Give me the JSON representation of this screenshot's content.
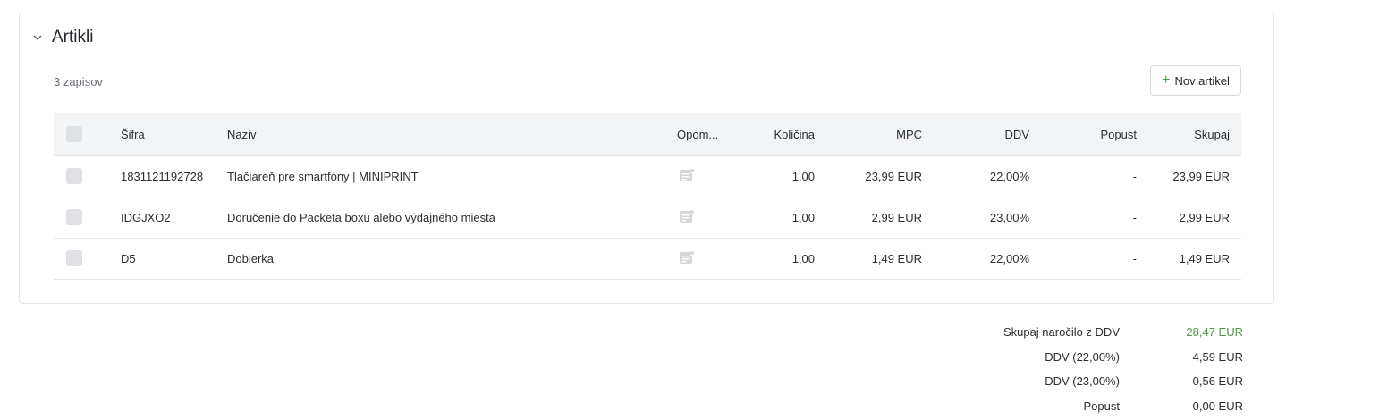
{
  "section": {
    "title": "Artikli",
    "count_label": "3 zapisov",
    "add_button_label": "Nov artikel",
    "chevron_icon": "chevron-down-icon",
    "accent_color": "#3f9b3c"
  },
  "table": {
    "columns": {
      "sifra": "Šifra",
      "naziv": "Naziv",
      "opombe": "Opom...",
      "kolicina": "Količina",
      "mpc": "MPC",
      "ddv": "DDV",
      "popust": "Popust",
      "skupaj": "Skupaj"
    },
    "rows": [
      {
        "sifra": "1831121192728",
        "naziv": "Tlačiareň pre smartfóny | MINIPRINT",
        "kolicina": "1,00",
        "mpc": "23,99 EUR",
        "ddv": "22,00%",
        "popust": "-",
        "skupaj": "23,99 EUR"
      },
      {
        "sifra": "IDGJXO2",
        "naziv": "Doručenie do Packeta boxu alebo výdajného miesta",
        "kolicina": "1,00",
        "mpc": "2,99 EUR",
        "ddv": "23,00%",
        "popust": "-",
        "skupaj": "2,99 EUR"
      },
      {
        "sifra": "D5",
        "naziv": "Dobierka",
        "kolicina": "1,00",
        "mpc": "1,49 EUR",
        "ddv": "22,00%",
        "popust": "-",
        "skupaj": "1,49 EUR"
      }
    ]
  },
  "totals": [
    {
      "label": "Skupaj naročilo z DDV",
      "value": "28,47 EUR"
    },
    {
      "label": "DDV (22,00%)",
      "value": "4,59 EUR"
    },
    {
      "label": "DDV (23,00%)",
      "value": "0,56 EUR"
    },
    {
      "label": "Popust",
      "value": "0,00 EUR"
    }
  ]
}
